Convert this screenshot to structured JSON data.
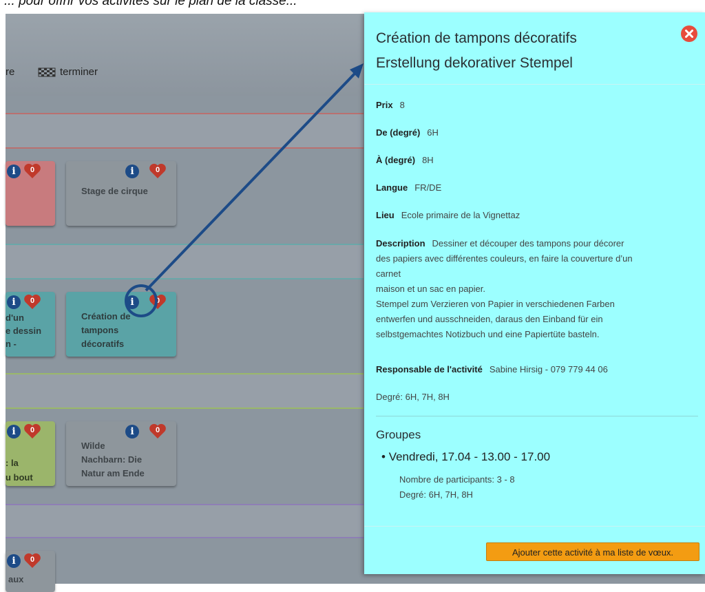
{
  "top_strip": {
    "text": "... pour offrir vos activités sur le plan de la classe..."
  },
  "nav": {
    "partial_label": "re",
    "finish_label": "terminer"
  },
  "cards": {
    "card_red": {
      "likes": "0"
    },
    "card_cirque": {
      "title": "Stage de cirque",
      "likes": "0"
    },
    "card_teal_partial": {
      "lines": [
        "d'un",
        "e dessin",
        "n -"
      ],
      "likes": "0"
    },
    "card_tampons": {
      "lines": [
        "Création de",
        "tampons",
        "décoratifs"
      ],
      "likes": "0"
    },
    "card_green_partial": {
      "lines": [
        ": la",
        "u bout"
      ],
      "likes": "0"
    },
    "card_wilde": {
      "lines": [
        "Wilde",
        "Nachbarn: Die",
        "Natur am Ende"
      ],
      "likes": "0"
    },
    "card_bottom_partial": {
      "lines": [
        "aux"
      ],
      "likes": "0"
    }
  },
  "detail": {
    "title_fr": "Création de tampons décoratifs",
    "title_de": "Erstellung dekorativer Stempel",
    "prix_label": "Prix",
    "prix_value": "8",
    "de_label": "De (degré)",
    "de_value": "6H",
    "a_label": "À (degré)",
    "a_value": "8H",
    "langue_label": "Langue",
    "langue_value": "FR/DE",
    "lieu_label": "Lieu",
    "lieu_value": "Ecole primaire de la Vignettaz",
    "description_label": "Description",
    "description_lines": [
      "Dessiner et découper des tampons pour décorer",
      "des papiers avec différentes couleurs, en faire la couverture d’un",
      "carnet",
      "maison et un sac en papier.",
      "Stempel zum Verzieren von Papier in verschiedenen Farben",
      "entwerfen und ausschneiden, daraus den Einband für ein",
      "selbstgemachtes Notizbuch und eine Papiertüte basteln."
    ],
    "responsable_label": "Responsable de l'activité",
    "responsable_value": "Sabine Hirsig - 079 779 44 06",
    "degre_line": "Degré: 6H, 7H, 8H",
    "groupes_title": "Groupes",
    "group_item": "Vendredi, 17.04 - 13.00 - 17.00",
    "group_participants": "Nombre de participants: 3 - 8",
    "group_degre": "Degré: 6H, 7H, 8H",
    "add_button": "Ajouter cette activité à ma liste de vœux."
  },
  "colors": {
    "panel_bg": "#9cffff",
    "info_icon": "#1d4b87",
    "heart_icon": "#c0392b",
    "arrow": "#1d4b87",
    "add_button_bg": "#f39c12",
    "card_red": "#c87b7e",
    "card_gray": "#8e969c",
    "card_teal": "#5aa3a6",
    "card_green": "#9bb56b"
  }
}
